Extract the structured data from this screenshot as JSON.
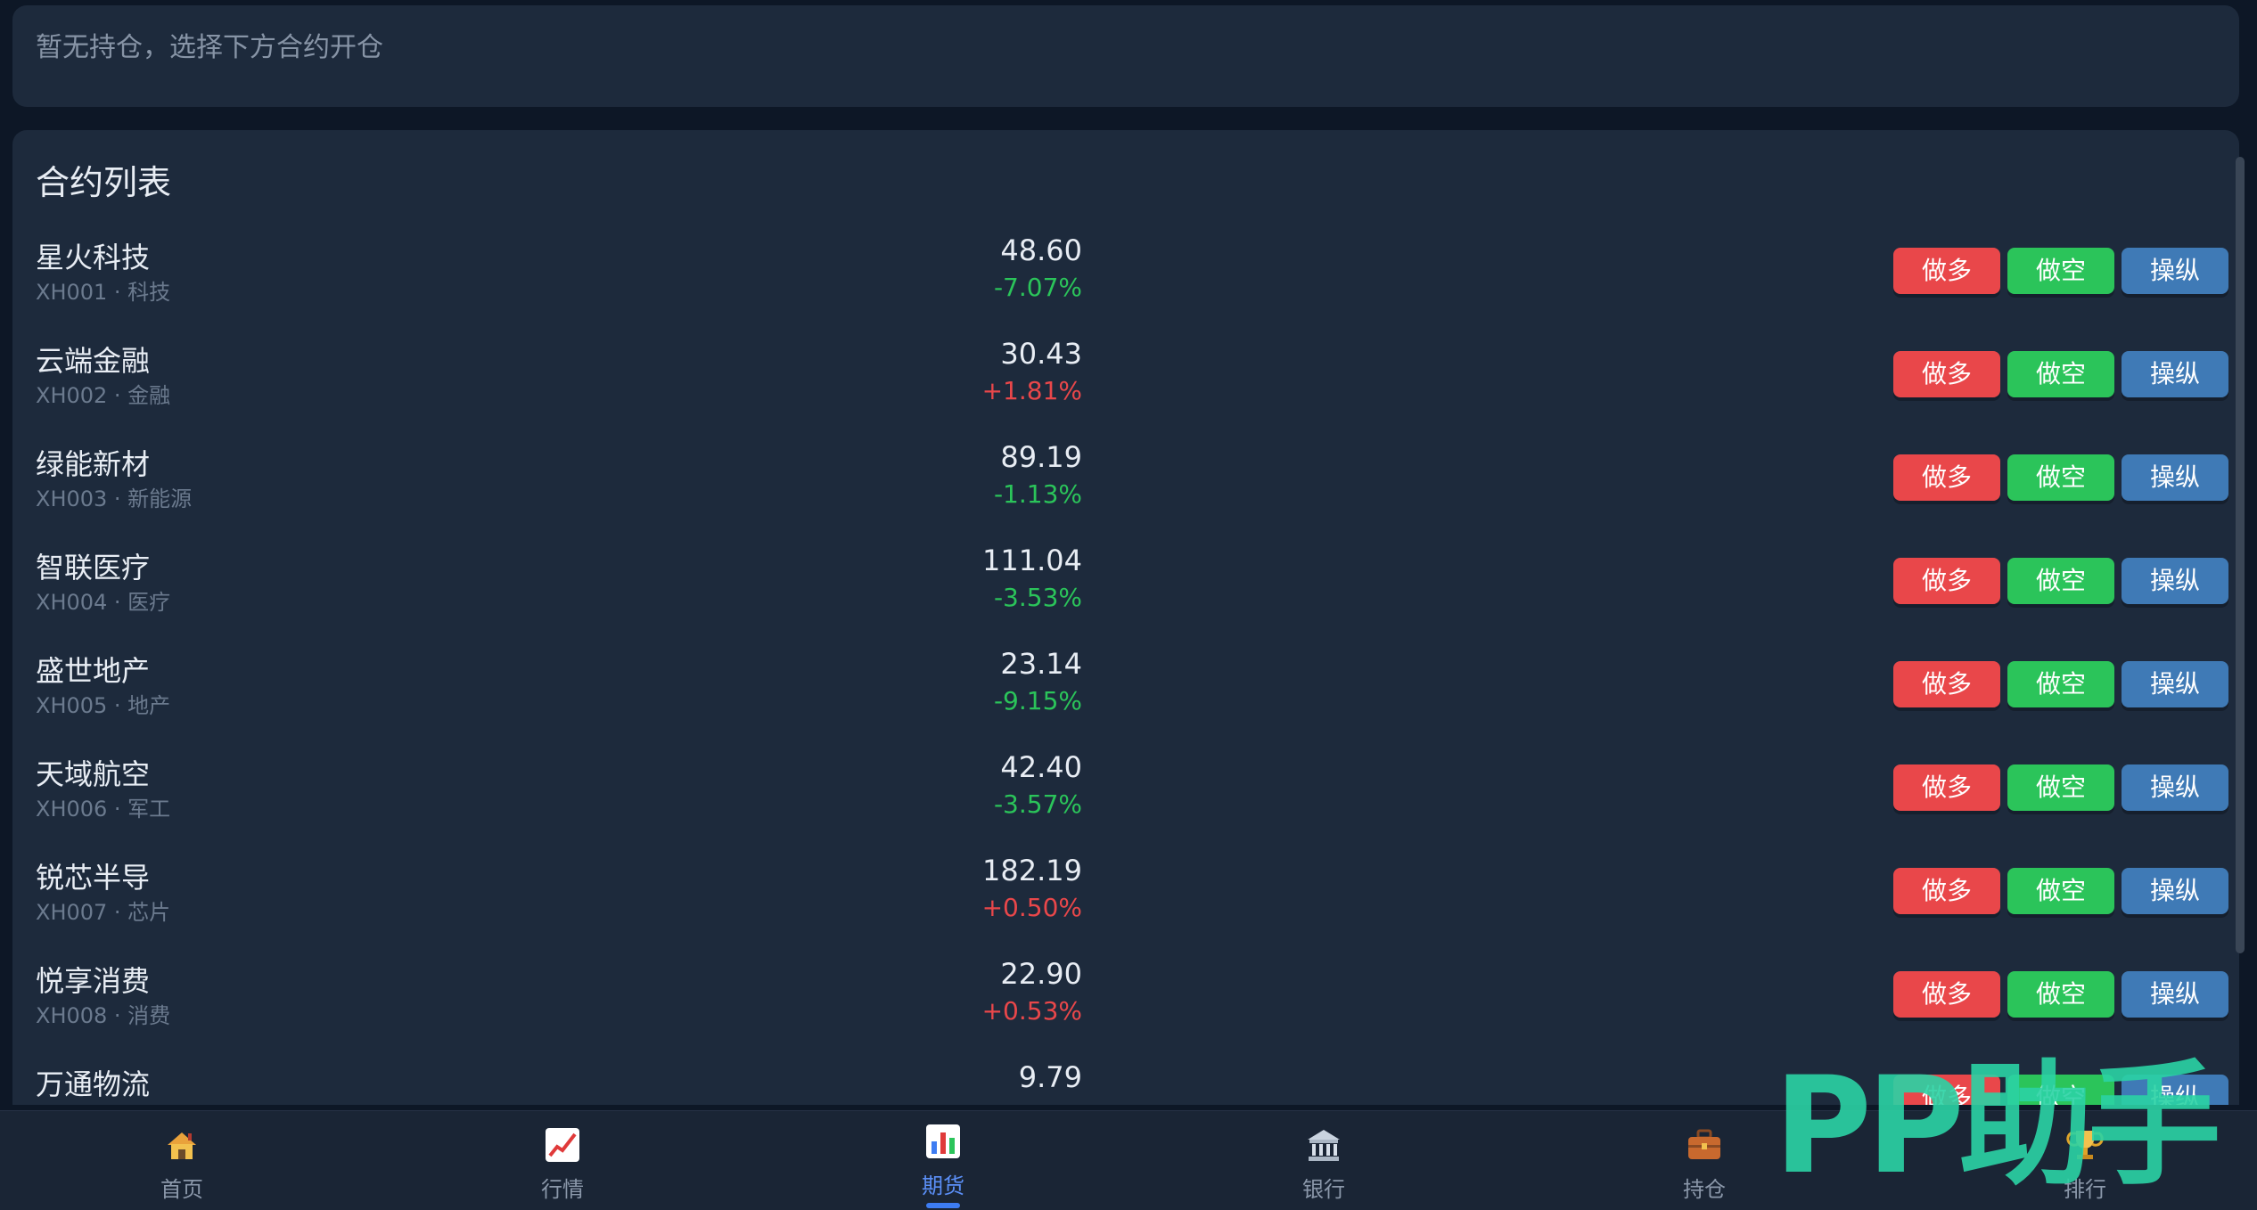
{
  "positions": {
    "empty_text": "暂无持仓，选择下方合约开仓"
  },
  "contracts": {
    "title": "合约列表",
    "rows": [
      {
        "name": "星火科技",
        "code": "XH001 · 科技",
        "price": "48.60",
        "change": "-7.07%",
        "dir": "down"
      },
      {
        "name": "云端金融",
        "code": "XH002 · 金融",
        "price": "30.43",
        "change": "+1.81%",
        "dir": "up"
      },
      {
        "name": "绿能新材",
        "code": "XH003 · 新能源",
        "price": "89.19",
        "change": "-1.13%",
        "dir": "down"
      },
      {
        "name": "智联医疗",
        "code": "XH004 · 医疗",
        "price": "111.04",
        "change": "-3.53%",
        "dir": "down"
      },
      {
        "name": "盛世地产",
        "code": "XH005 · 地产",
        "price": "23.14",
        "change": "-9.15%",
        "dir": "down"
      },
      {
        "name": "天域航空",
        "code": "XH006 · 军工",
        "price": "42.40",
        "change": "-3.57%",
        "dir": "down"
      },
      {
        "name": "锐芯半导",
        "code": "XH007 · 芯片",
        "price": "182.19",
        "change": "+0.50%",
        "dir": "up"
      },
      {
        "name": "悦享消费",
        "code": "XH008 · 消费",
        "price": "22.90",
        "change": "+0.53%",
        "dir": "up"
      },
      {
        "name": "万通物流",
        "code": "",
        "price": "9.79",
        "change": "",
        "dir": "up"
      }
    ],
    "buttons": {
      "long": "做多",
      "short": "做空",
      "control": "操纵"
    }
  },
  "colors": {
    "up": "#e9474a",
    "down": "#2bc45a",
    "accent": "#3d7cf2"
  },
  "nav": [
    {
      "label": "首页",
      "icon": "home-icon"
    },
    {
      "label": "行情",
      "icon": "chart-line-icon"
    },
    {
      "label": "期货",
      "icon": "bar-chart-icon",
      "active": true
    },
    {
      "label": "银行",
      "icon": "bank-icon"
    },
    {
      "label": "持仓",
      "icon": "briefcase-icon"
    },
    {
      "label": "排行",
      "icon": "trophy-icon"
    }
  ],
  "watermark": {
    "text": "PP助手"
  }
}
